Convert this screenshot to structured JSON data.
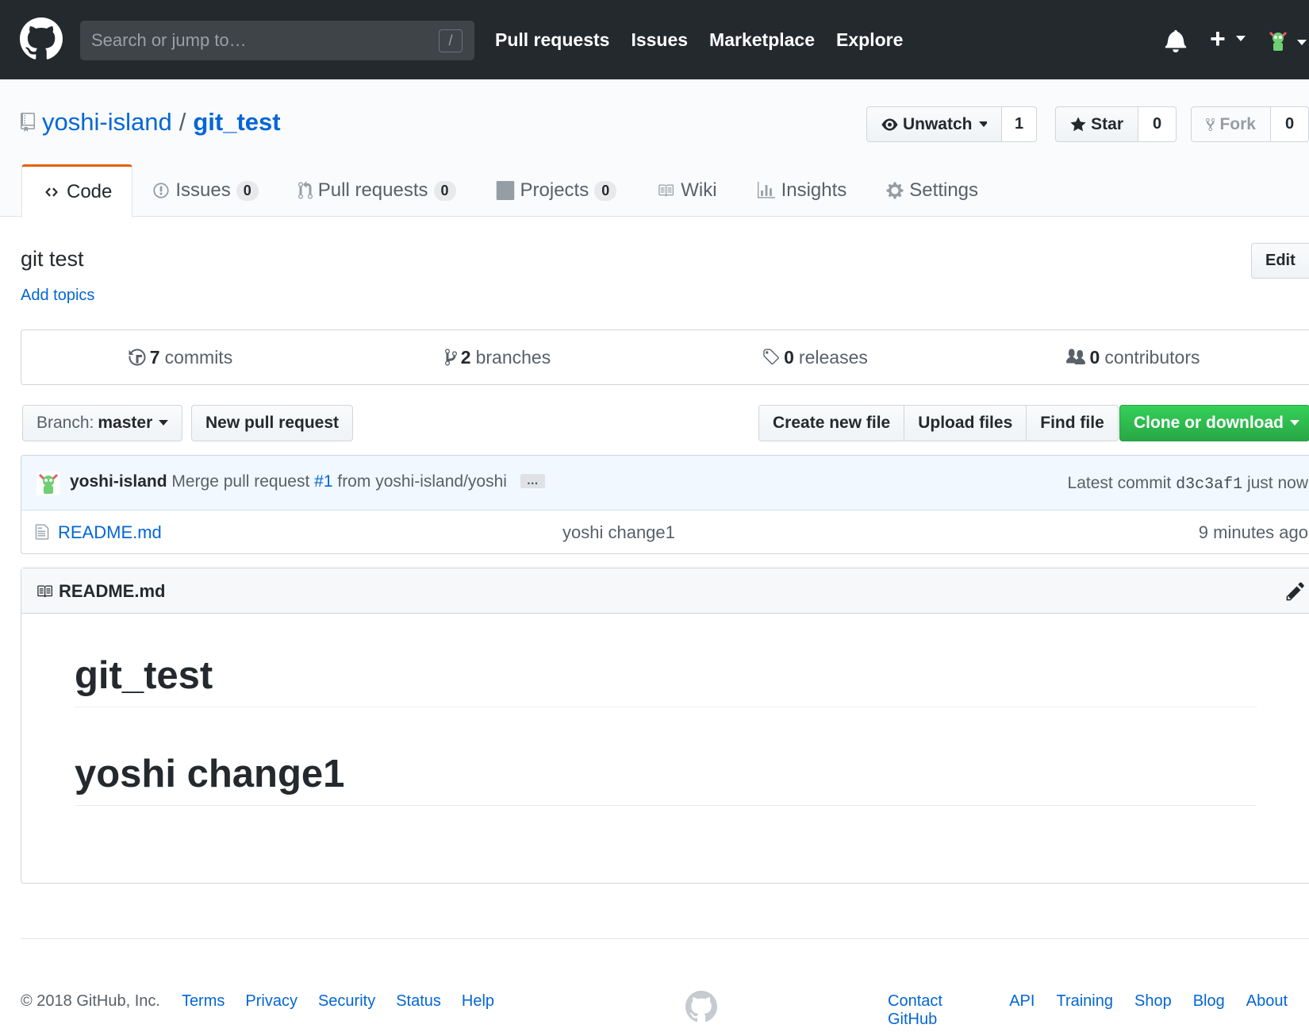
{
  "header": {
    "search_placeholder": "Search or jump to…",
    "search_shortcut": "/",
    "nav": [
      "Pull requests",
      "Issues",
      "Marketplace",
      "Explore"
    ],
    "plus_label": "+"
  },
  "repo": {
    "owner": "yoshi-island",
    "separator": "/",
    "name": "git_test",
    "watch_label": "Unwatch",
    "watch_count": "1",
    "star_label": "Star",
    "star_count": "0",
    "fork_label": "Fork",
    "fork_count": "0"
  },
  "tabs": [
    {
      "label": "Code",
      "icon": "code-icon"
    },
    {
      "label": "Issues",
      "count": "0",
      "icon": "issue-icon"
    },
    {
      "label": "Pull requests",
      "count": "0",
      "icon": "pull-request-icon"
    },
    {
      "label": "Projects",
      "count": "0",
      "icon": "project-icon"
    },
    {
      "label": "Wiki",
      "icon": "book-icon"
    },
    {
      "label": "Insights",
      "icon": "graph-icon"
    },
    {
      "label": "Settings",
      "icon": "gear-icon"
    }
  ],
  "description": {
    "text": "git test",
    "add_topics": "Add topics",
    "edit_label": "Edit"
  },
  "summary": {
    "commits_count": "7",
    "commits_label": "commits",
    "branches_count": "2",
    "branches_label": "branches",
    "releases_count": "0",
    "releases_label": "releases",
    "contributors_count": "0",
    "contributors_label": "contributors"
  },
  "file_nav": {
    "branch_prefix": "Branch:",
    "branch_name": "master",
    "new_pr": "New pull request",
    "create_file": "Create new file",
    "upload_files": "Upload files",
    "find_file": "Find file",
    "clone": "Clone or download"
  },
  "commit": {
    "author": "yoshi-island",
    "message_pre": "Merge pull request",
    "issue": "#1",
    "message_post": "from yoshi-island/yoshi",
    "ellipsis": "…",
    "latest_label": "Latest commit",
    "sha": "d3c3af1",
    "time": "just now"
  },
  "files": [
    {
      "name": "README.md",
      "message": "yoshi change1",
      "age": "9 minutes ago"
    }
  ],
  "readme": {
    "title": "README.md",
    "h1_first": "git_test",
    "h1_second": "yoshi change1"
  },
  "footer": {
    "copyright": "© 2018 GitHub, Inc.",
    "left_links": [
      "Terms",
      "Privacy",
      "Security",
      "Status",
      "Help"
    ],
    "right_links": [
      "Contact GitHub",
      "API",
      "Training",
      "Shop",
      "Blog",
      "About"
    ]
  },
  "colors": {
    "header_bg": "#24292e",
    "link": "#0366d6",
    "tab_accent": "#e36209",
    "clone_green": "#28a745",
    "commit_bg": "#f1f8ff"
  }
}
